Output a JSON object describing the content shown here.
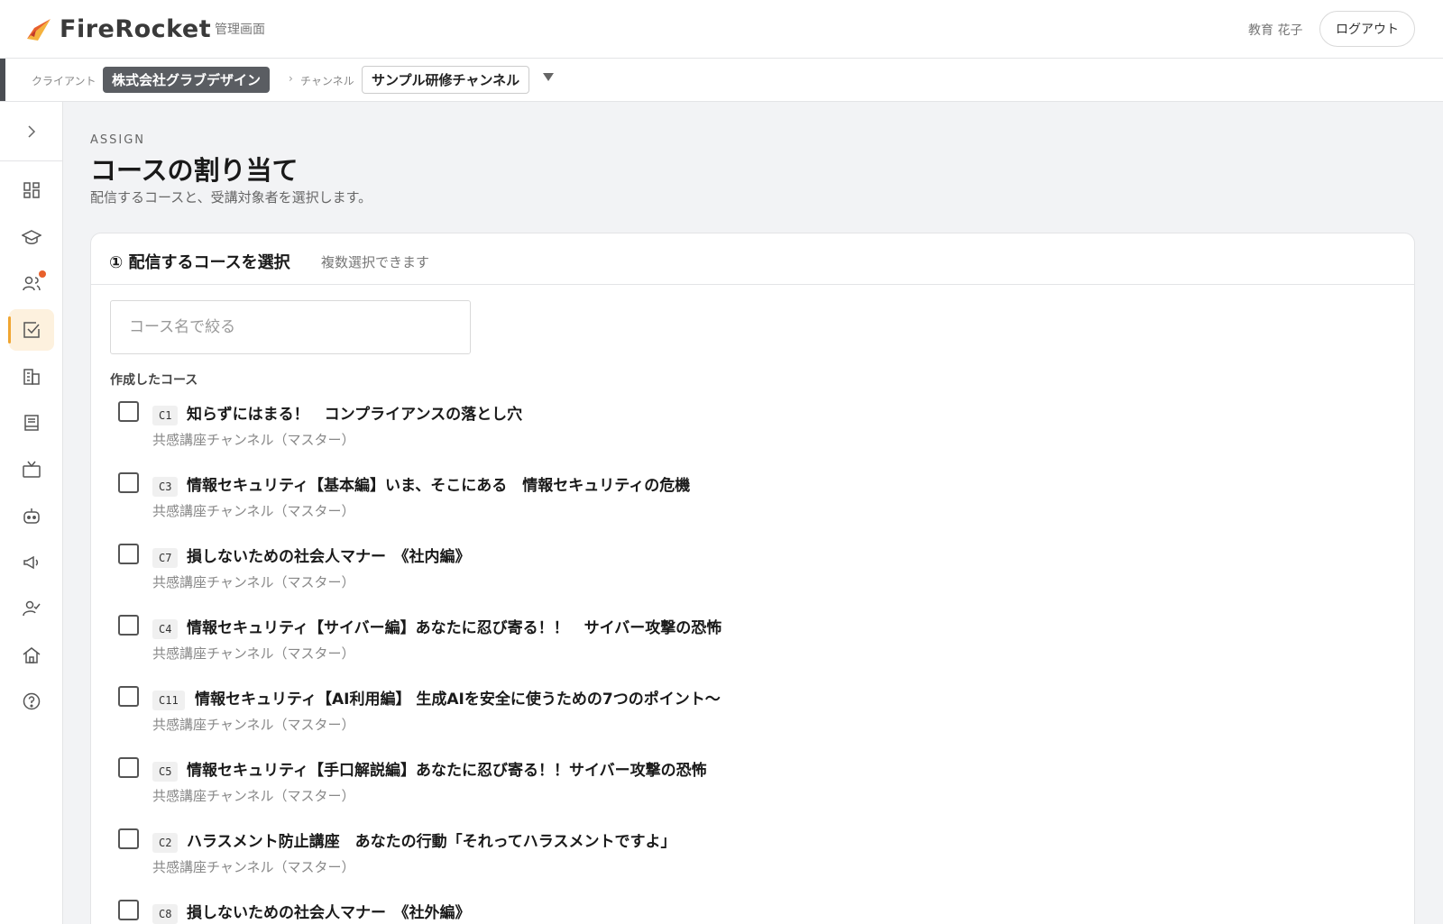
{
  "header": {
    "app_name": "FireRocket",
    "admin_label": "管理画面",
    "user_name": "教育 花子",
    "logout_label": "ログアウト"
  },
  "breadcrumb": {
    "client_label": "クライアント",
    "client_value": "株式会社グラブデザイン",
    "separator": "›",
    "channel_label": "チャンネル",
    "channel_value": "サンプル研修チャンネル"
  },
  "sidebar": {
    "items": [
      {
        "icon": "dashboard-icon",
        "active": false
      },
      {
        "icon": "graduation-cap-icon",
        "active": false
      },
      {
        "icon": "users-icon",
        "active": false,
        "notification": true
      },
      {
        "icon": "assign-check-icon",
        "active": true
      },
      {
        "icon": "building-icon",
        "active": false
      },
      {
        "icon": "book-icon",
        "active": false
      },
      {
        "icon": "tv-icon",
        "active": false
      },
      {
        "icon": "robot-icon",
        "active": false
      },
      {
        "icon": "megaphone-icon",
        "active": false
      },
      {
        "icon": "user-check-icon",
        "active": false
      },
      {
        "icon": "home-icon",
        "active": false
      },
      {
        "icon": "help-icon",
        "active": false
      }
    ]
  },
  "page": {
    "eyebrow": "ASSIGN",
    "title": "コースの割り当て",
    "subtitle": "配信するコースと、受講対象者を選択します。"
  },
  "course_select": {
    "title": "① 配信するコースを選択",
    "hint": "複数選択できます",
    "filter_placeholder": "コース名で絞る",
    "section_label": "作成したコース",
    "courses": [
      {
        "code": "C1",
        "title": "知らずにはまる！　コンプライアンスの落とし穴",
        "channel": "共感講座チャンネル（マスター）",
        "checked": false
      },
      {
        "code": "C3",
        "title": "情報セキュリティ【基本編】いま、そこにある　情報セキュリティの危機",
        "channel": "共感講座チャンネル（マスター）",
        "checked": false
      },
      {
        "code": "C7",
        "title": "損しないための社会人マナー　《社内編》",
        "channel": "共感講座チャンネル（マスター）",
        "checked": false
      },
      {
        "code": "C4",
        "title": "情報セキュリティ【サイバー編】あなたに忍び寄る！！　サイバー攻撃の恐怖",
        "channel": "共感講座チャンネル（マスター）",
        "checked": false
      },
      {
        "code": "C11",
        "title": "情報セキュリティ【AI利用編】 生成AIを安全に使うための7つのポイント～",
        "channel": "共感講座チャンネル（マスター）",
        "checked": false
      },
      {
        "code": "C5",
        "title": "情報セキュリティ【手口解説編】あなたに忍び寄る！！サイバー攻撃の恐怖",
        "channel": "共感講座チャンネル（マスター）",
        "checked": false
      },
      {
        "code": "C2",
        "title": "ハラスメント防止講座　あなたの行動「それってハラスメントですよ」",
        "channel": "共感講座チャンネル（マスター）",
        "checked": false
      },
      {
        "code": "C8",
        "title": "損しないための社会人マナー　《社外編》",
        "channel": "",
        "checked": false
      }
    ]
  }
}
